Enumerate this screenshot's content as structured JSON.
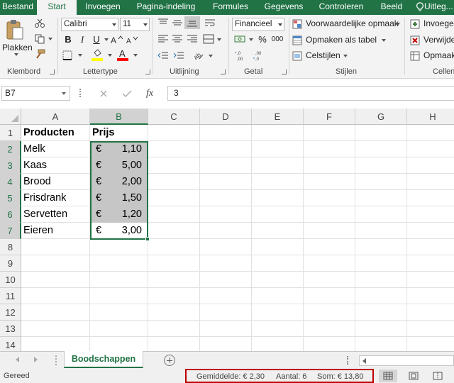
{
  "ribbon_tabs": [
    "Bestand",
    "Start",
    "Invoegen",
    "Pagina-indeling",
    "Formules",
    "Gegevens",
    "Controleren",
    "Beeld",
    "Uitleg..."
  ],
  "active_tab": "Start",
  "clipboard": {
    "paste_label": "Plakken",
    "group_label": "Klembord"
  },
  "font": {
    "name": "Calibri",
    "size": "11",
    "bold": "B",
    "italic": "I",
    "underline": "U",
    "font_color_letter": "A",
    "group_label": "Lettertype",
    "highlight_color": "#ffff00",
    "font_color": "#ff0000"
  },
  "alignment": {
    "group_label": "Uitlijning"
  },
  "number": {
    "format": "Financieel",
    "percent": "%",
    "thousands": "000",
    "group_label": "Getal"
  },
  "styles": {
    "conditional_formatting": "Voorwaardelijke opmaak",
    "format_as_table": "Opmaken als tabel",
    "cell_styles": "Celstijlen",
    "group_label": "Stijlen"
  },
  "cells_group": {
    "insert": "Invoegen",
    "delete": "Verwijde...",
    "format": "Opmaak",
    "group_label": "Cellen"
  },
  "formula_bar": {
    "name_box": "B7",
    "fx": "fx",
    "formula": "3"
  },
  "grid": {
    "columns": [
      "A",
      "B",
      "C",
      "D",
      "E",
      "F",
      "G",
      "H"
    ],
    "selected_column": "B",
    "rows": [
      "1",
      "2",
      "3",
      "4",
      "5",
      "6",
      "7",
      "8",
      "9",
      "10",
      "11",
      "12",
      "13",
      "14"
    ],
    "header": {
      "product": "Producten",
      "price": "Prijs"
    },
    "currency_symbol": "€",
    "items": [
      {
        "product": "Melk",
        "price": "1,10"
      },
      {
        "product": "Kaas",
        "price": "5,00"
      },
      {
        "product": "Brood",
        "price": "2,00"
      },
      {
        "product": "Frisdrank",
        "price": "1,50"
      },
      {
        "product": "Servetten",
        "price": "1,20"
      },
      {
        "product": "Eieren",
        "price": "3,00"
      }
    ]
  },
  "sheet_tabs": {
    "active": "Boodschappen"
  },
  "status_bar": {
    "ready": "Gereed",
    "average": "Gemiddelde:  € 2,30",
    "count": "Aantal: 6",
    "sum": "Som:  € 13,80"
  },
  "colors": {
    "excel_green": "#217346",
    "selection_fill": "#c6c6c6",
    "highlight_box": "#c00000"
  }
}
